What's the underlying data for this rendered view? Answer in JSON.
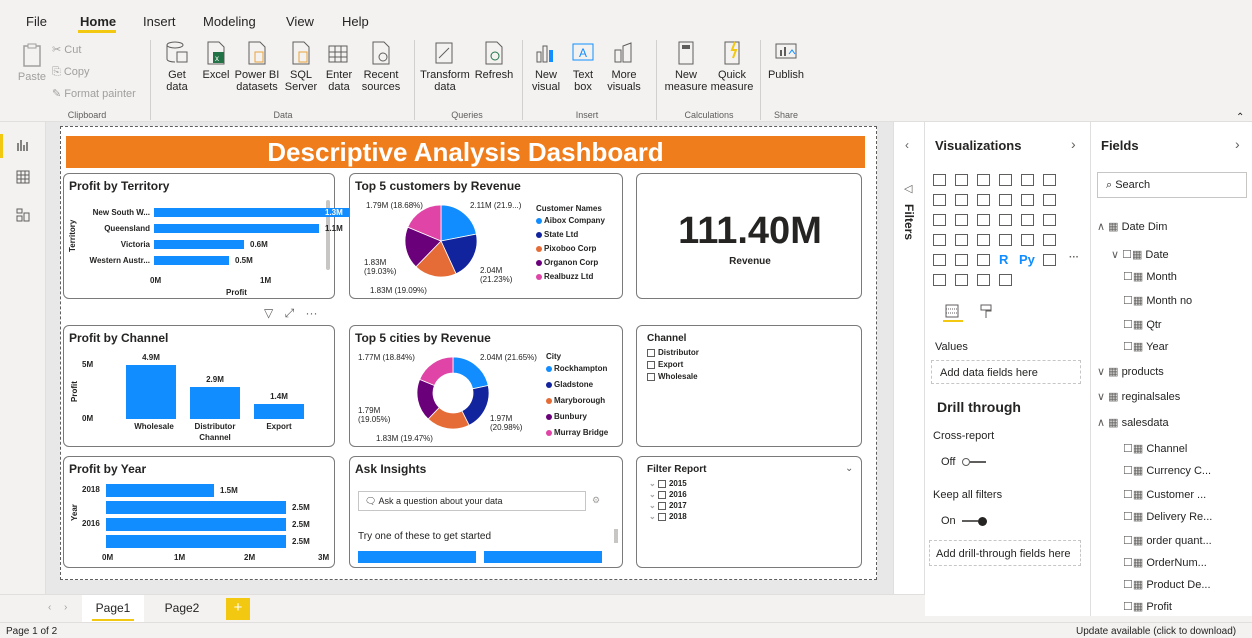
{
  "menu": {
    "items": [
      "File",
      "Home",
      "Insert",
      "Modeling",
      "View",
      "Help"
    ]
  },
  "ribbon": {
    "clipboard": {
      "paste": "Paste",
      "cut": "Cut",
      "copy": "Copy",
      "format_painter": "Format painter",
      "group": "Clipboard"
    },
    "data": {
      "get_data": "Get data",
      "excel": "Excel",
      "power_bi": "Power BI datasets",
      "sql": "SQL Server",
      "enter": "Enter data",
      "recent": "Recent sources",
      "group": "Data"
    },
    "queries": {
      "transform": "Transform data",
      "refresh": "Refresh",
      "group": "Queries"
    },
    "insert": {
      "new_visual": "New visual",
      "text_box": "Text box",
      "more_visuals": "More visuals",
      "group": "Insert"
    },
    "calculations": {
      "new_measure": "New measure",
      "quick_measure": "Quick measure",
      "group": "Calculations"
    },
    "share": {
      "publish": "Publish",
      "group": "Share"
    }
  },
  "dashboard": {
    "title": "Descriptive Analysis Dashboard"
  },
  "territory": {
    "title": "Profit by Territory",
    "axis_y": "Territory",
    "axis_x": "Profit",
    "rows": [
      {
        "name": "New South W...",
        "label": "1.3M",
        "value": 1.3
      },
      {
        "name": "Queensland",
        "label": "1.1M",
        "value": 1.1
      },
      {
        "name": "Victoria",
        "label": "0.6M",
        "value": 0.6
      },
      {
        "name": "Western Austr...",
        "label": "0.5M",
        "value": 0.5
      }
    ],
    "ticks": [
      "0M",
      "1M"
    ]
  },
  "customers": {
    "title": "Top 5 customers by Revenue",
    "legend_title": "Customer Names",
    "legend": [
      {
        "name": "Aibox Company",
        "color": "#118dff"
      },
      {
        "name": "State Ltd",
        "color": "#12239e"
      },
      {
        "name": "Pixoboo Corp",
        "color": "#e66c37"
      },
      {
        "name": "Organon Corp",
        "color": "#6b007b"
      },
      {
        "name": "Realbuzz Ltd",
        "color": "#e044a7"
      }
    ],
    "labels": [
      "1.79M (18.68%)",
      "2.11M (21.9...)",
      "1.83M (19.03%)",
      "2.04M (21.23%)",
      "1.83M (19.09%)"
    ]
  },
  "revenue": {
    "value": "111.40M",
    "label": "Revenue"
  },
  "channel": {
    "title": "Profit by Channel",
    "axis_y": "Profit",
    "axis_x": "Channel",
    "ticks": [
      "5M",
      "0M"
    ],
    "bars": [
      {
        "name": "Wholesale",
        "label": "4.9M",
        "value": 4.9
      },
      {
        "name": "Distributor",
        "label": "2.9M",
        "value": 2.9
      },
      {
        "name": "Export",
        "label": "1.4M",
        "value": 1.4
      }
    ]
  },
  "cities": {
    "title": "Top 5 cities by Revenue",
    "legend_title": "City",
    "legend": [
      {
        "name": "Rockhampton",
        "color": "#118dff"
      },
      {
        "name": "Gladstone",
        "color": "#12239e"
      },
      {
        "name": "Maryborough",
        "color": "#e66c37"
      },
      {
        "name": "Bunbury",
        "color": "#6b007b"
      },
      {
        "name": "Murray Bridge",
        "color": "#e044a7"
      }
    ],
    "labels": [
      "1.77M (18.84%)",
      "2.04M (21.65%)",
      "1.79M (19.05%)",
      "1.97M (20.98%)",
      "1.83M (19.47%)"
    ]
  },
  "channel_slicer": {
    "title": "Channel",
    "items": [
      "Distributor",
      "Export",
      "Wholesale"
    ]
  },
  "year": {
    "title": "Profit by Year",
    "axis_y": "Year",
    "ticks": [
      "0M",
      "1M",
      "2M",
      "3M"
    ],
    "rows": [
      {
        "name": "2018",
        "label": "1.5M",
        "value": 1.5
      },
      {
        "name": "",
        "label": "2.5M",
        "value": 2.5
      },
      {
        "name": "2016",
        "label": "2.5M",
        "value": 2.5
      },
      {
        "name": "",
        "label": "2.5M",
        "value": 2.5
      }
    ]
  },
  "insights": {
    "title": "Ask Insights",
    "placeholder": "Ask a question about your data",
    "hint": "Try one of these to get started"
  },
  "filter_report": {
    "title": "Filter Report",
    "items": [
      "2015",
      "2016",
      "2017",
      "2018"
    ]
  },
  "filters_pane": {
    "label": "Filters"
  },
  "visualizations": {
    "title": "Visualizations",
    "values_label": "Values",
    "add_fields": "Add data fields here",
    "drill_title": "Drill through",
    "cross_report": "Cross-report",
    "off": "Off",
    "keep_filters": "Keep all filters",
    "on": "On",
    "add_drill": "Add drill-through fields here",
    "r_label": "R",
    "py_label": "Py",
    "more": "···"
  },
  "fields": {
    "title": "Fields",
    "search_placeholder": "Search",
    "items": [
      {
        "text": "Date Dim",
        "indent": 0
      },
      {
        "text": "Date",
        "indent": 1
      },
      {
        "text": "Month",
        "indent": 2
      },
      {
        "text": "Month no",
        "indent": 2
      },
      {
        "text": "Qtr",
        "indent": 2
      },
      {
        "text": "Year",
        "indent": 2
      },
      {
        "text": "products",
        "indent": 0
      },
      {
        "text": "reginalsales",
        "indent": 0
      },
      {
        "text": "salesdata",
        "indent": 0
      },
      {
        "text": "Channel",
        "indent": 2
      },
      {
        "text": "Currency C...",
        "indent": 2
      },
      {
        "text": "Customer ...",
        "indent": 2
      },
      {
        "text": "Delivery Re...",
        "indent": 2
      },
      {
        "text": "order quant...",
        "indent": 2
      },
      {
        "text": "OrderNum...",
        "indent": 2
      },
      {
        "text": "Product De...",
        "indent": 2
      },
      {
        "text": "Profit",
        "indent": 2
      }
    ]
  },
  "tabs": {
    "page1": "Page1",
    "page2": "Page2",
    "add": "+"
  },
  "status": {
    "page": "Page 1 of 2",
    "update": "Update available (click to download)"
  }
}
